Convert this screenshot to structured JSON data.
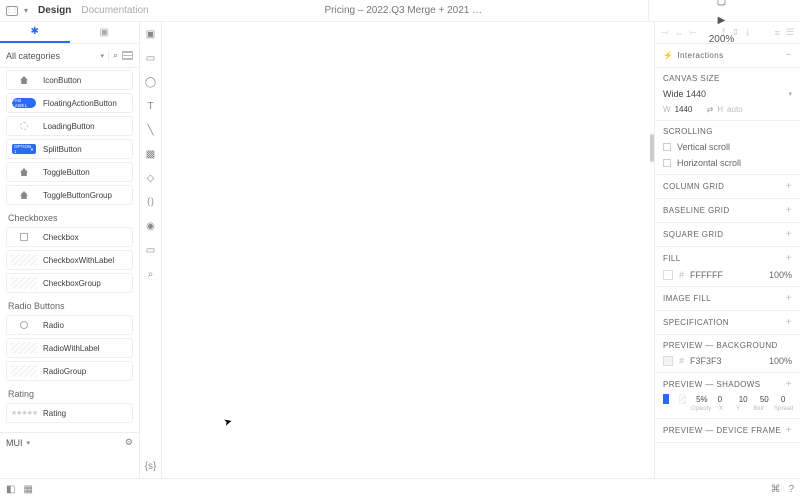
{
  "topbar": {
    "tab_design": "Design",
    "tab_docs": "Documentation",
    "title": "Pricing – 2022.Q3 Merge + 2021 …",
    "zoom": "200%"
  },
  "leftPanel": {
    "category": "All categories",
    "groups": [
      {
        "title": "",
        "items": [
          {
            "name": "IconButton",
            "thumb": "home"
          },
          {
            "name": "FloatingActionButton",
            "thumb": "fab",
            "fabText": "FAB LABEL"
          },
          {
            "name": "LoadingButton",
            "thumb": "spinner"
          },
          {
            "name": "SplitButton",
            "thumb": "split",
            "splitText": "OPTION 1"
          },
          {
            "name": "ToggleButton",
            "thumb": "home"
          },
          {
            "name": "ToggleButtonGroup",
            "thumb": "home"
          }
        ]
      },
      {
        "title": "Checkboxes",
        "items": [
          {
            "name": "Checkbox",
            "thumb": "chk"
          },
          {
            "name": "CheckboxWithLabel",
            "thumb": "hatch"
          },
          {
            "name": "CheckboxGroup",
            "thumb": "hatch"
          }
        ]
      },
      {
        "title": "Radio Buttons",
        "items": [
          {
            "name": "Radio",
            "thumb": "radio"
          },
          {
            "name": "RadioWithLabel",
            "thumb": "hatch"
          },
          {
            "name": "RadioGroup",
            "thumb": "hatch"
          }
        ]
      },
      {
        "title": "Rating",
        "items": [
          {
            "name": "Rating",
            "thumb": "stars"
          }
        ]
      }
    ],
    "footer": "MUI"
  },
  "rightPanel": {
    "interactions": {
      "label": "Interactions"
    },
    "canvasSize": {
      "label": "CANVAS SIZE",
      "preset": "Wide 1440",
      "w": "1440",
      "h": "auto"
    },
    "scrolling": {
      "label": "SCROLLING",
      "vertical": "Vertical scroll",
      "horizontal": "Horizontal scroll"
    },
    "columnGrid": {
      "label": "COLUMN GRID"
    },
    "baselineGrid": {
      "label": "BASELINE GRID"
    },
    "squareGrid": {
      "label": "SQUARE GRID"
    },
    "fill": {
      "label": "FILL",
      "hex": "FFFFFF",
      "opacity": "100%"
    },
    "imageFill": {
      "label": "IMAGE FILL"
    },
    "specification": {
      "label": "SPECIFICATION"
    },
    "previewBg": {
      "label": "PREVIEW — BACKGROUND",
      "hex": "F3F3F3",
      "opacity": "100%"
    },
    "previewShadows": {
      "label": "PREVIEW — SHADOWS",
      "opacity": "5%",
      "x": "0",
      "y": "10",
      "blur": "50",
      "spread": "0",
      "l_opacity": "Opacity",
      "l_x": "X",
      "l_y": "Y",
      "l_blur": "Blur",
      "l_spread": "Spread"
    },
    "previewDevice": {
      "label": "PREVIEW — DEVICE FRAME"
    }
  }
}
